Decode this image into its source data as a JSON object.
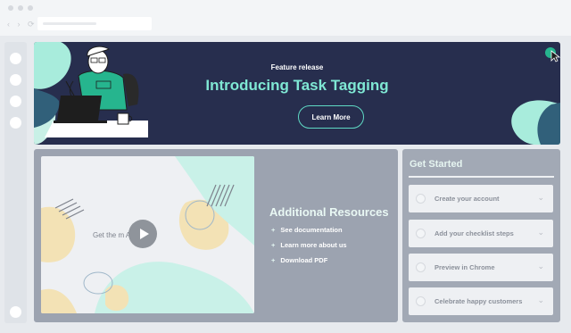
{
  "browser": {
    "nav_arrows": "‹ › ⟳"
  },
  "hero": {
    "kicker": "Feature release",
    "title": "Introducing Task Tagging",
    "button": "Learn More"
  },
  "resources": {
    "video_caption": "Get the m          Acme Co.",
    "title": "Additional Resources",
    "links": [
      {
        "label": "See documentation"
      },
      {
        "label": "Learn more about us"
      },
      {
        "label": "Download PDF"
      }
    ],
    "bullet": "+"
  },
  "getstarted": {
    "title": "Get Started",
    "items": [
      {
        "label": "Create your account"
      },
      {
        "label": "Add your checklist steps"
      },
      {
        "label": "Preview in Chrome"
      },
      {
        "label": "Celebrate happy customers"
      }
    ],
    "chevron": "⌄"
  },
  "colors": {
    "hero_bg": "#272e4e",
    "accent_teal": "#7fe8d4",
    "blob_yellow": "#f3e2b5",
    "blob_mint": "#c9f1e8",
    "panel_gray": "#9ca3b0"
  }
}
